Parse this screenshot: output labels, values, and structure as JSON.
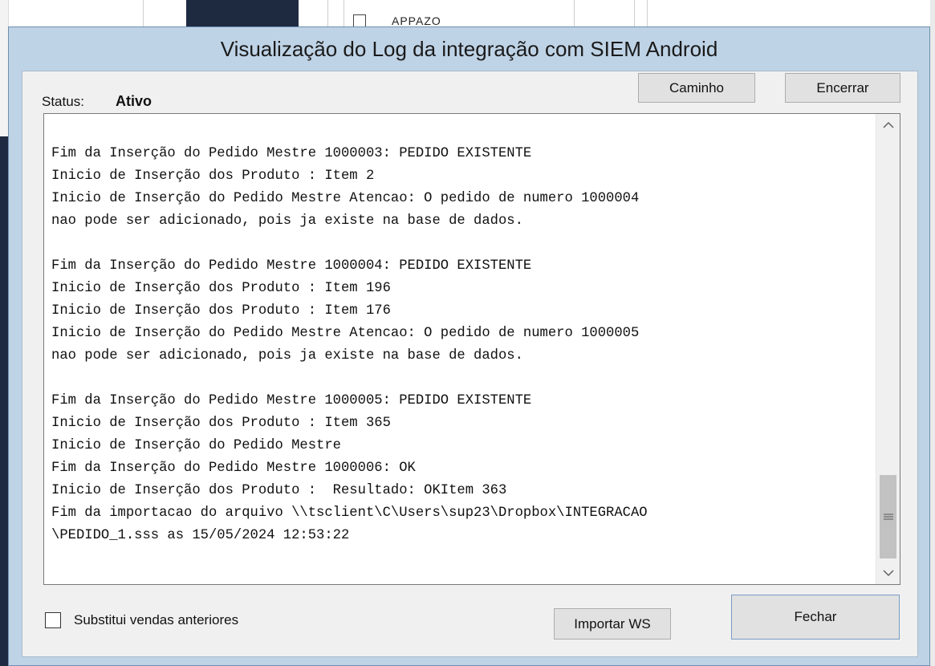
{
  "background": {
    "partial_text": "APPAZO"
  },
  "dialog": {
    "title": "Visualização do Log da integração com SIEM Android",
    "status_label": "Status:",
    "status_value": "Ativo",
    "buttons": {
      "caminho": "Caminho",
      "encerrar": "Encerrar",
      "importar_ws": "Importar WS",
      "fechar": "Fechar"
    },
    "log_lines": [
      "Fim da Inserção do Pedido Mestre 1000003: PEDIDO EXISTENTE",
      "Inicio de Inserção dos Produto : Item 2",
      "Inicio de Inserção do Pedido Mestre Atencao: O pedido de numero 1000004",
      "nao pode ser adicionado, pois ja existe na base de dados.",
      "",
      "Fim da Inserção do Pedido Mestre 1000004: PEDIDO EXISTENTE",
      "Inicio de Inserção dos Produto : Item 196",
      "Inicio de Inserção dos Produto : Item 176",
      "Inicio de Inserção do Pedido Mestre Atencao: O pedido de numero 1000005",
      "nao pode ser adicionado, pois ja existe na base de dados.",
      "",
      "Fim da Inserção do Pedido Mestre 1000005: PEDIDO EXISTENTE",
      "Inicio de Inserção dos Produto : Item 365",
      "Inicio de Inserção do Pedido Mestre",
      "Fim da Inserção do Pedido Mestre 1000006: OK",
      "Inicio de Inserção dos Produto :  Resultado: OKItem 363",
      "Fim da importacao do arquivo \\\\tsclient\\C\\Users\\sup23\\Dropbox\\INTEGRACAO",
      "\\PEDIDO_1.sss as 15/05/2024 12:53:22"
    ],
    "scrollbar": {
      "up_icon": "chevron-up-icon",
      "down_icon": "chevron-down-icon",
      "thumb_icon": "grip-icon"
    },
    "checkbox": {
      "label": "Substitui vendas anteriores",
      "checked": false
    }
  }
}
